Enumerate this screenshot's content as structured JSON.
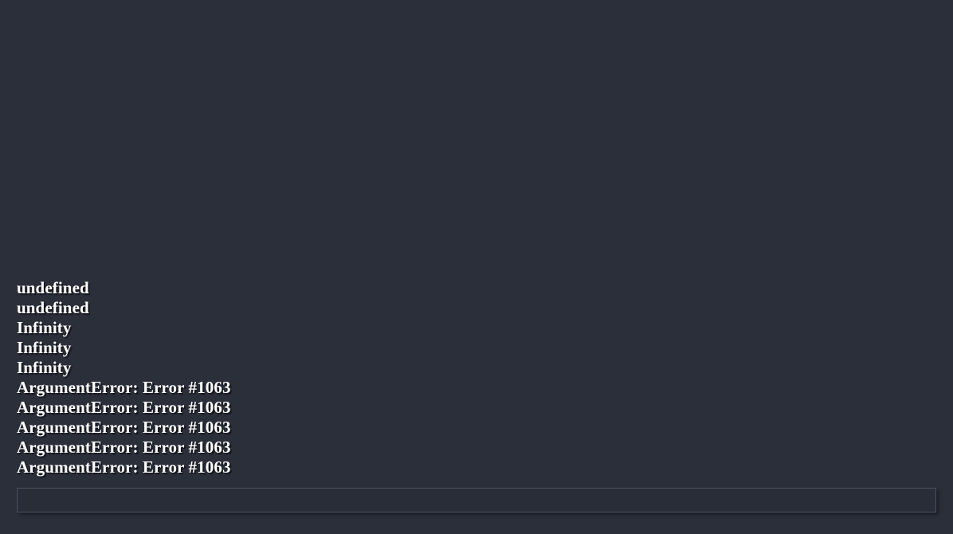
{
  "window": {
    "background_color": "#2b2f3a"
  },
  "console": {
    "output_lines": [
      "undefined",
      "undefined",
      "Infinity",
      "Infinity",
      "Infinity",
      "ArgumentError: Error #1063",
      "ArgumentError: Error #1063",
      "ArgumentError: Error #1063",
      "ArgumentError: Error #1063",
      "ArgumentError: Error #1063"
    ],
    "input": {
      "value": "",
      "placeholder": ""
    },
    "text_color": "#ffffff",
    "input_border_color": "#4b5163",
    "input_background_color": "#292d37"
  }
}
